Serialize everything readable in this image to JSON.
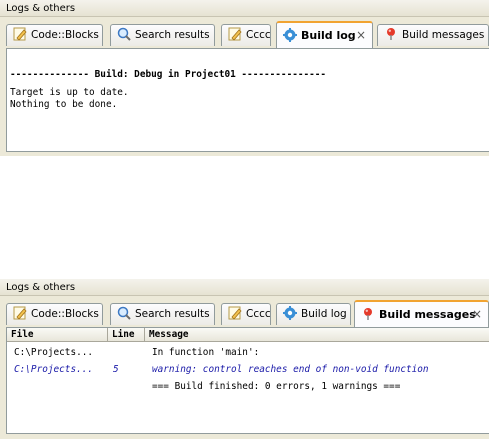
{
  "panel_top": {
    "title": "Logs & others",
    "tabs": [
      {
        "label": "Code::Blocks",
        "icon": "pencil-icon"
      },
      {
        "label": "Search results",
        "icon": "magnifier-icon"
      },
      {
        "label": "Cccc",
        "icon": "pencil-icon"
      },
      {
        "label": "Build log",
        "icon": "gear-icon",
        "active": true,
        "close": "×"
      },
      {
        "label": "Build messages",
        "icon": "pin-icon"
      }
    ],
    "log": {
      "header": "-------------- Build: Debug in Project01 ---------------",
      "lines": [
        "Target is up to date.",
        "Nothing to be done."
      ]
    }
  },
  "panel_bottom": {
    "title": "Logs & others",
    "tabs": [
      {
        "label": "Code::Blocks",
        "icon": "pencil-icon"
      },
      {
        "label": "Search results",
        "icon": "magnifier-icon"
      },
      {
        "label": "Cccc",
        "icon": "pencil-icon"
      },
      {
        "label": "Build log",
        "icon": "gear-icon"
      },
      {
        "label": "Build messages",
        "icon": "pin-icon",
        "active": true,
        "close": "×"
      }
    ],
    "columns": [
      "File",
      "Line",
      "Message"
    ],
    "rows": [
      {
        "file": "C:\\Projects...",
        "line": "",
        "message": "In function 'main':",
        "kind": "normal"
      },
      {
        "file": "C:\\Projects...",
        "line": "5",
        "message": "warning: control reaches end of non-void function",
        "kind": "warning"
      },
      {
        "file": "",
        "line": "",
        "message": "=== Build finished: 0 errors, 1 warnings ===",
        "kind": "normal"
      }
    ]
  },
  "colors": {
    "accent_tab": "#f1a331",
    "warning_text": "#1a1aa8",
    "panel_bg": "#ece9d8"
  }
}
